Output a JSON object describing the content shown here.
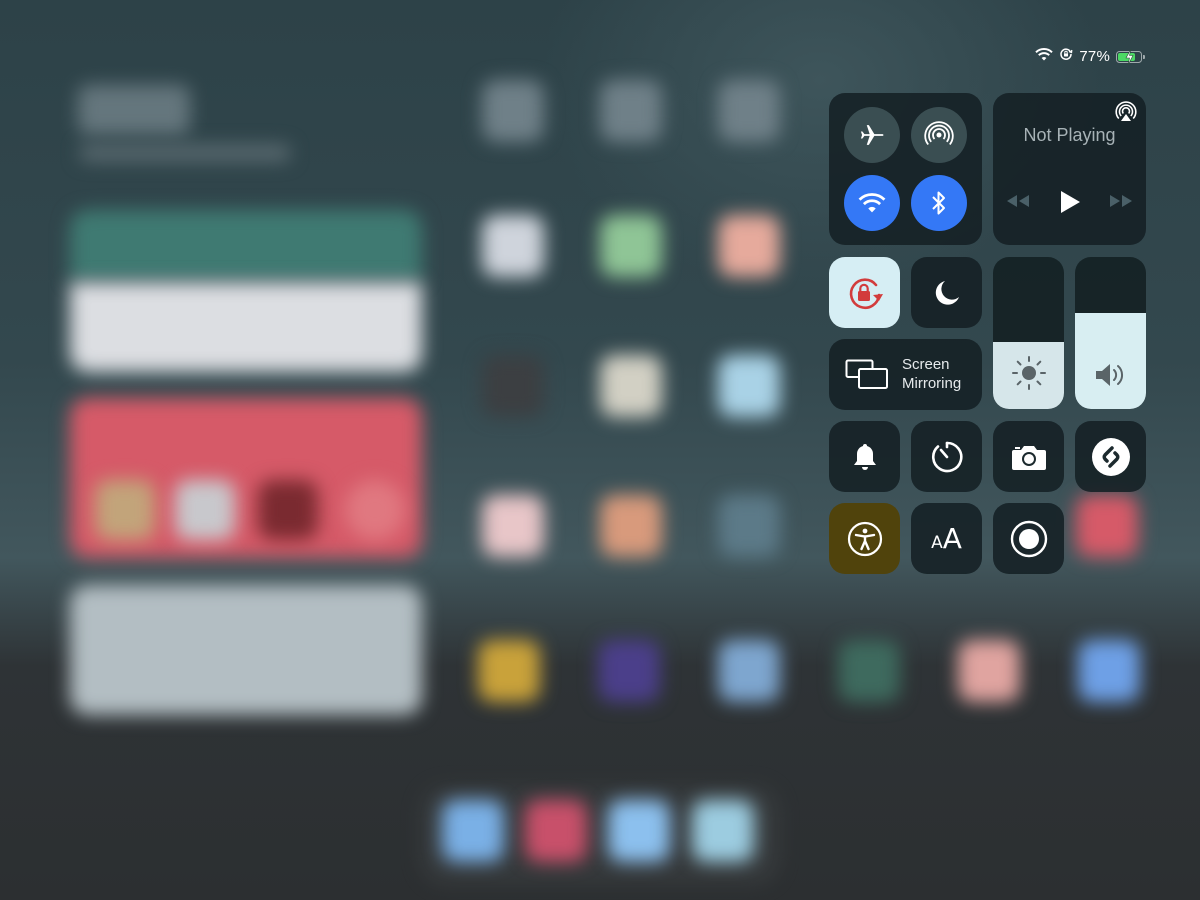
{
  "status_bar": {
    "wifi_icon": "wifi-icon",
    "orientation_lock_icon": "orientation-lock-icon",
    "battery_percent": "77%",
    "battery_level": 0.77,
    "charging": true
  },
  "control_center": {
    "connectivity": {
      "airplane_mode": {
        "icon": "airplane-icon",
        "on": false
      },
      "airdrop": {
        "icon": "airdrop-icon",
        "on": false
      },
      "wifi": {
        "icon": "wifi-icon",
        "on": true
      },
      "bluetooth": {
        "icon": "bluetooth-icon",
        "on": true
      }
    },
    "now_playing": {
      "title": "Not Playing",
      "airplay_icon": "airplay-audio-icon",
      "controls": [
        "rewind-icon",
        "play-icon",
        "fast-forward-icon"
      ]
    },
    "orientation_lock": {
      "icon": "orientation-lock-icon",
      "on": true
    },
    "do_not_disturb": {
      "icon": "moon-icon",
      "on": false
    },
    "screen_mirroring": {
      "label_line1": "Screen",
      "label_line2": "Mirroring",
      "icon": "screen-mirroring-icon"
    },
    "brightness": {
      "icon": "sun-icon",
      "level_percent": 44
    },
    "volume": {
      "icon": "speaker-icon",
      "level_percent": 63
    },
    "row_tiles": [
      {
        "name": "silent-mode",
        "icon": "bell-icon"
      },
      {
        "name": "timer",
        "icon": "timer-icon"
      },
      {
        "name": "camera",
        "icon": "camera-icon"
      },
      {
        "name": "shazam",
        "icon": "shazam-icon"
      },
      {
        "name": "accessibility-shortcut",
        "icon": "accessibility-icon"
      },
      {
        "name": "text-size",
        "icon": "text-size-icon",
        "label": "AA"
      },
      {
        "name": "screen-recording",
        "icon": "record-icon"
      }
    ],
    "colors": {
      "accent_blue": "#3478f6",
      "orientation_lock_red": "#d23c3c",
      "accessibility_tint": "#5a4a0c",
      "battery_green": "#4cd964"
    }
  }
}
